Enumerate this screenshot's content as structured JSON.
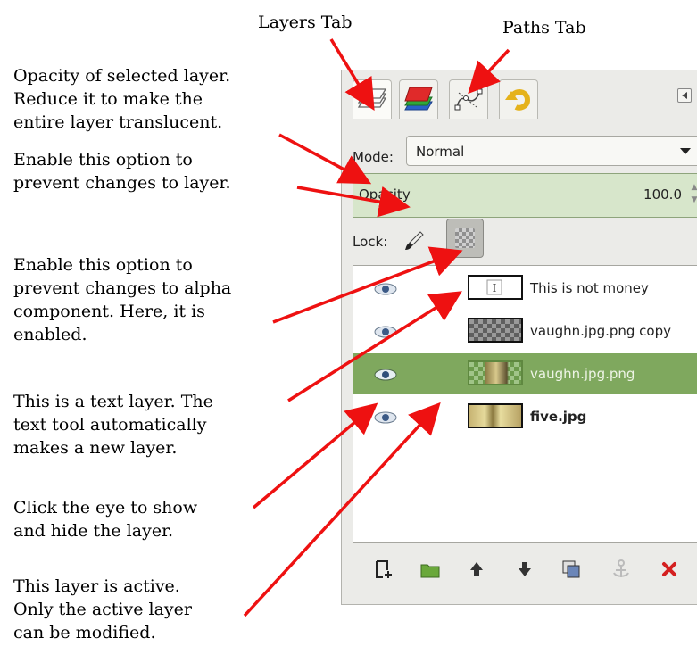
{
  "captions": {
    "layers_tab": "Layers Tab",
    "paths_tab": "Paths Tab"
  },
  "notes": {
    "opacity": "Opacity of selected layer.\nReduce it to make the\nentire layer translucent.",
    "lock_pixels": "Enable this option to\nprevent changes to layer.",
    "lock_alpha": "Enable this option to\nprevent changes to alpha\ncomponent.  Here, it is\nenabled.",
    "text_layer": "This is a text layer.  The\ntext tool automatically\nmakes a new layer.",
    "eye": "Click the eye to show\nand hide the layer.",
    "active": "This layer is active.\nOnly the active layer\ncan be modified."
  },
  "panel": {
    "tabs": [
      {
        "icon": "layers-icon"
      },
      {
        "icon": "channels-icon"
      },
      {
        "icon": "paths-icon"
      },
      {
        "icon": "undo-history-icon"
      }
    ],
    "mode": {
      "label": "Mode:",
      "value": "Normal"
    },
    "opacity": {
      "label": "Opacity",
      "value": "100.0"
    },
    "lock": {
      "label": "Lock:",
      "alpha_locked": true
    },
    "layers": [
      {
        "name": "This is not money",
        "kind": "text",
        "visible": true,
        "active": false,
        "bold": false
      },
      {
        "name": "vaughn.jpg.png copy",
        "kind": "checker",
        "visible": true,
        "active": false,
        "bold": false
      },
      {
        "name": "vaughn.jpg.png",
        "kind": "image",
        "visible": true,
        "active": true,
        "bold": false
      },
      {
        "name": "five.jpg",
        "kind": "money",
        "visible": true,
        "active": false,
        "bold": true
      }
    ],
    "bottom_buttons": [
      "new-layer-icon",
      "new-layer-group-icon",
      "raise-layer-icon",
      "lower-layer-icon",
      "duplicate-layer-icon",
      "anchor-layer-icon",
      "delete-layer-icon"
    ]
  },
  "colors": {
    "arrow": "#ee1111",
    "active_row": "#7fa85e",
    "opacity_bg": "#d7e6cb"
  }
}
